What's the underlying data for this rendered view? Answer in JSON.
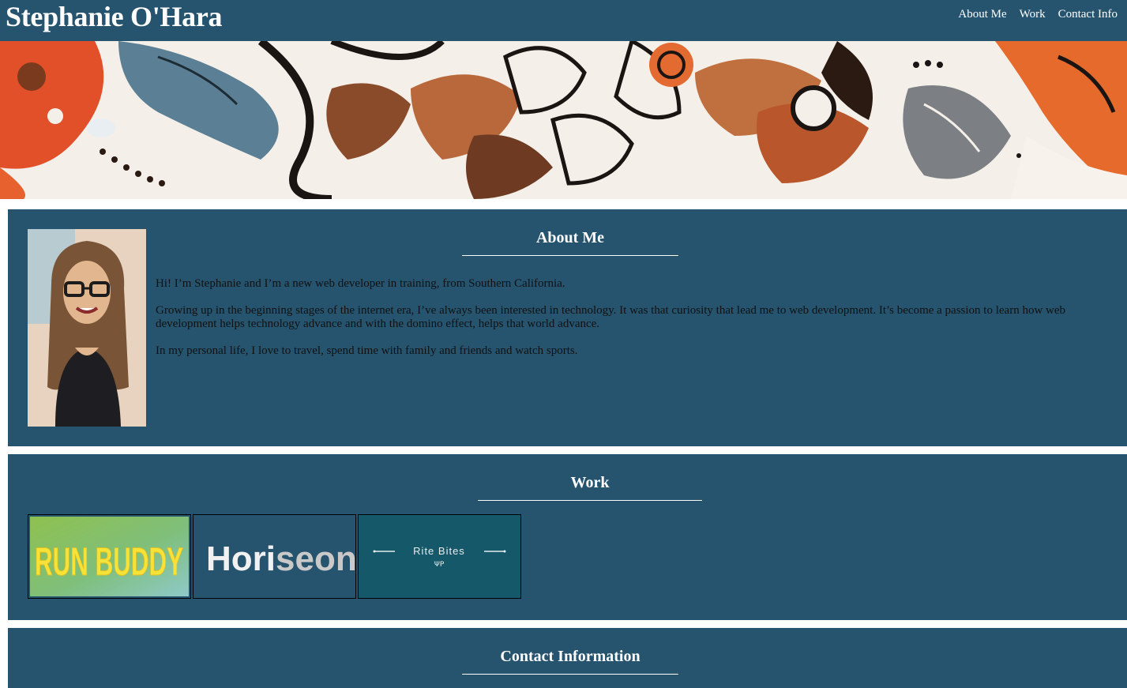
{
  "header": {
    "title": "Stephanie O'Hara",
    "nav": [
      {
        "label": "About Me"
      },
      {
        "label": "Work"
      },
      {
        "label": "Contact Info"
      }
    ]
  },
  "about": {
    "heading": "About Me",
    "paragraphs": [
      "Hi! I’m Stephanie and I’m a new web developer in training, from Southern California.",
      "Growing up in the beginning stages of the internet era, I’ve always been interested in technology. It was that curiosity that lead me to web development. It’s become a passion to learn how web development helps technology advance and with the domino effect, helps that world advance.",
      "In my personal life, I love to travel, spend time with family and friends and watch sports."
    ]
  },
  "work": {
    "heading": "Work",
    "projects": [
      {
        "label": "RUN BUDDY"
      },
      {
        "label_part1": "Hori",
        "label_part2": "seon"
      },
      {
        "label": "Rite Bites",
        "sub": "ΨP"
      }
    ]
  },
  "contact": {
    "heading": "Contact Information"
  },
  "colors": {
    "header_bg": "#26546f",
    "section_bg": "#26546f",
    "text_light": "#ffffff",
    "text_dark": "#111111"
  }
}
